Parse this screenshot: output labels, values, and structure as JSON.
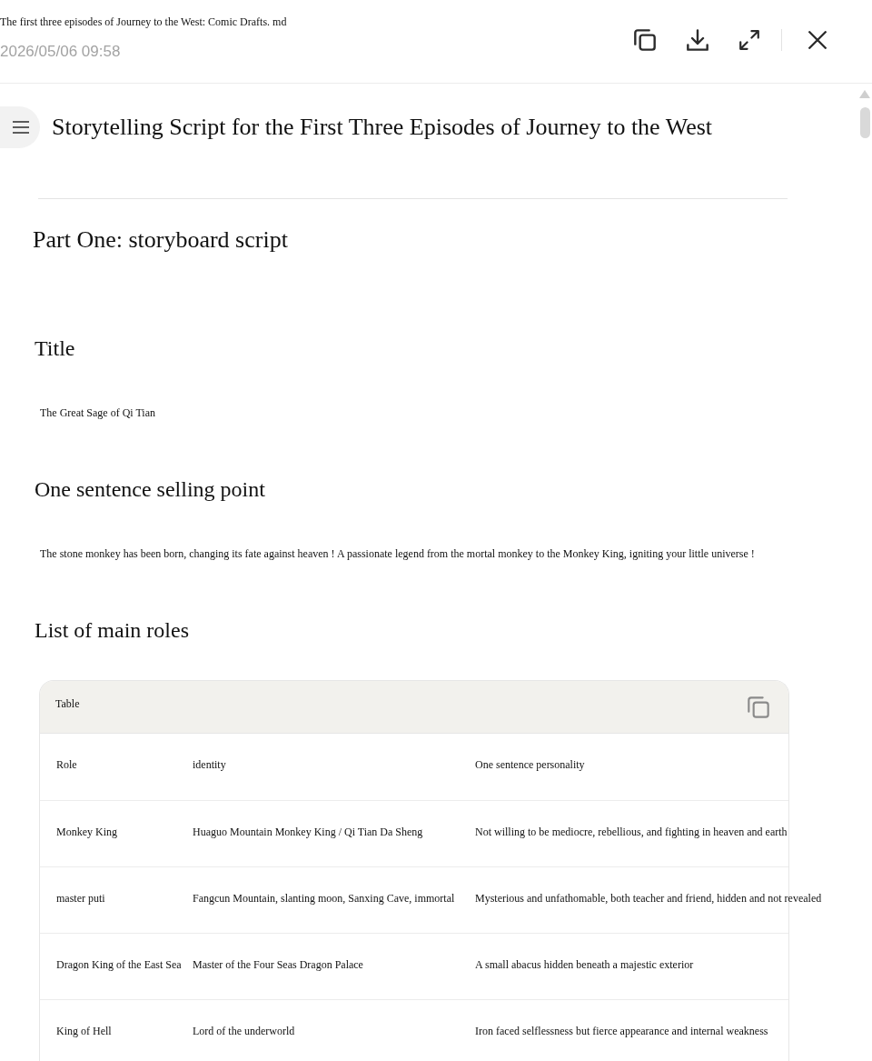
{
  "header": {
    "file_name": "The first three episodes of Journey to the West: Comic Drafts. md",
    "timestamp": "2026/05/06 09:58"
  },
  "document": {
    "title": "Storytelling Script for the First Three Episodes of Journey to the West",
    "blocks": [
      {
        "kind": "heading1",
        "text": "Part One: storyboard script"
      },
      {
        "kind": "heading2",
        "text": "Title"
      },
      {
        "kind": "paragraph",
        "text": "The Great Sage of Qi Tian"
      },
      {
        "kind": "heading2",
        "text": "One sentence selling point"
      },
      {
        "kind": "paragraph",
        "text": "The stone monkey has been born, changing its fate against heaven ! A passionate legend from the mortal monkey to the Monkey King, igniting your little universe !"
      },
      {
        "kind": "heading2",
        "text": "List of main roles"
      },
      {
        "kind": "table",
        "label": "Table",
        "columns": [
          "Role",
          "identity",
          "One sentence personality"
        ],
        "rows": [
          [
            "Monkey King",
            "Huaguo Mountain Monkey King / Qi Tian Da Sheng",
            "Not willing to be mediocre, rebellious, and fighting in heaven and earth"
          ],
          [
            "master puti",
            "Fangcun Mountain, slanting moon, Sanxing Cave, immortal",
            "Mysterious and unfathomable, both teacher and friend, hidden and not revealed"
          ],
          [
            "Dragon King of the East Sea",
            "Master of the Four Seas Dragon Palace",
            "A small abacus hidden beneath a majestic exterior"
          ],
          [
            "King of Hell",
            "Lord of the underworld",
            "Iron faced selflessness but fierce appearance and internal weakness"
          ]
        ]
      }
    ]
  }
}
